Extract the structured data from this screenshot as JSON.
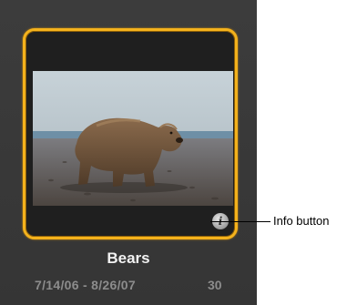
{
  "event": {
    "title": "Bears",
    "date_range": "7/14/06 - 8/26/07",
    "photo_count": "30",
    "photo_subject": "brown bear walking on a beach",
    "selected": true,
    "selection_color": "#f4b21c",
    "info_icon": "info-icon",
    "info_glyph": "i"
  },
  "callout": {
    "label": "Info button"
  }
}
